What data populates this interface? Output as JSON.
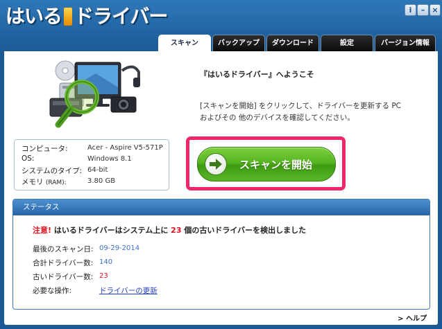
{
  "app": {
    "logo_text_part1": "はいる",
    "logo_text_part2": "ドライバー"
  },
  "window_buttons": {
    "info": "i",
    "minimize": "–",
    "close": "×"
  },
  "tabs": [
    {
      "label": "スキャン",
      "active": true
    },
    {
      "label": "バックアップ",
      "active": false
    },
    {
      "label": "ダウンロード",
      "active": false
    },
    {
      "label": "設定",
      "active": false
    },
    {
      "label": "バージョン情報",
      "active": false
    }
  ],
  "welcome": {
    "title": "『はいるドライバー』へようこそ",
    "text": "[スキャンを開始] をクリックして、ドライバーを更新する PC およびその 他のデバイスを確認してください。"
  },
  "system_info": {
    "computer_label": "コンピュータ:",
    "computer_value": "Acer - Aspire V5-571P",
    "os_label": "OS:",
    "os_value": "Windows 8.1",
    "systype_label": "システムのタイプ:",
    "systype_value": "64-bit",
    "memory_label": "メモリ",
    "memory_unit": "(RAM):",
    "memory_value": "3.80 GB"
  },
  "scan_button": {
    "label": "スキャンを開始"
  },
  "status": {
    "header": "ステータス",
    "alert_prefix": "注意!",
    "alert_text1": "はいるドライバーはシステム上に",
    "alert_count": "23",
    "alert_text2": "個の古いドライバーを検出しました",
    "last_scan_label": "最後のスキャン日:",
    "last_scan_value": "09-29-2014",
    "total_label": "合計ドライバー数:",
    "total_value": "140",
    "old_label": "古いドライバー数:",
    "old_value": "23",
    "action_label": "必要な操作:",
    "action_link": "ドライバーの更新"
  },
  "help": {
    "label": "> ヘルプ"
  },
  "colors": {
    "accent_blue": "#1e5f9c",
    "scan_green": "#56b420",
    "highlight_pink": "#f0266b",
    "alert_red": "#e01020"
  }
}
